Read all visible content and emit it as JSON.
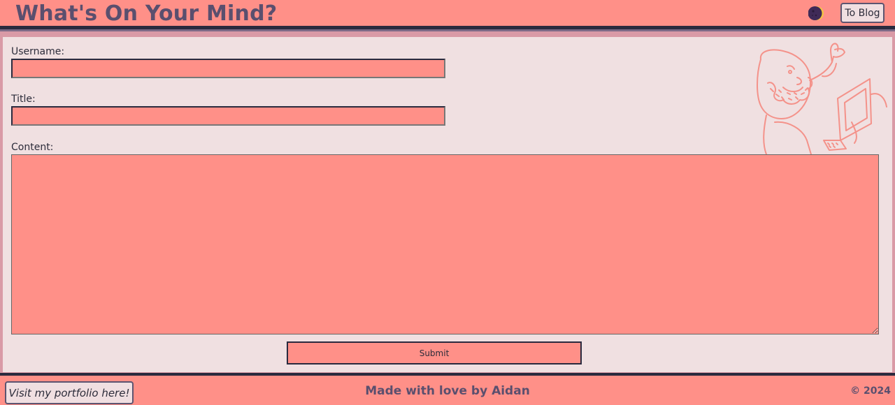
{
  "header": {
    "title": "What's On Your Mind?",
    "theme_toggle_icon": "moon-icon",
    "to_blog_label": "To Blog"
  },
  "form": {
    "username_label": "Username:",
    "username_value": "",
    "title_label": "Title:",
    "title_value": "",
    "content_label": "Content:",
    "content_value": "",
    "submit_label": "Submit"
  },
  "footer": {
    "portfolio_label": "Visit my portfolio here!",
    "made_with": "Made with love by Aidan",
    "copyright": "© 2024"
  },
  "colors": {
    "accent": "#ff9088",
    "panel": "#f0e0e1",
    "dark": "#2a2a3e",
    "title_text": "#5a4f6e"
  }
}
